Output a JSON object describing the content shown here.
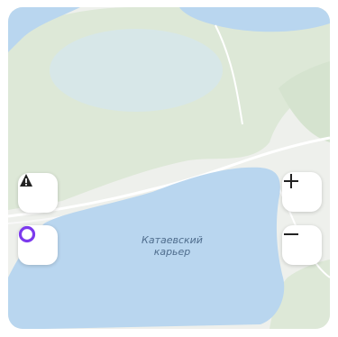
{
  "map": {
    "label_line1": "Катаевский",
    "label_line2": "карьер",
    "colors": {
      "land": "#eef0ec",
      "water": "#b9d6ef",
      "forest": "#dce8d6",
      "road": "#ffffff",
      "label": "#4f6d8d"
    }
  },
  "controls": {
    "road_alert_icon": "road-alert-icon",
    "assistant_icon": "alice-assistant-icon",
    "zoom_in_label": "+",
    "zoom_out_label": "−",
    "assistant_color": "#7c3aed"
  }
}
